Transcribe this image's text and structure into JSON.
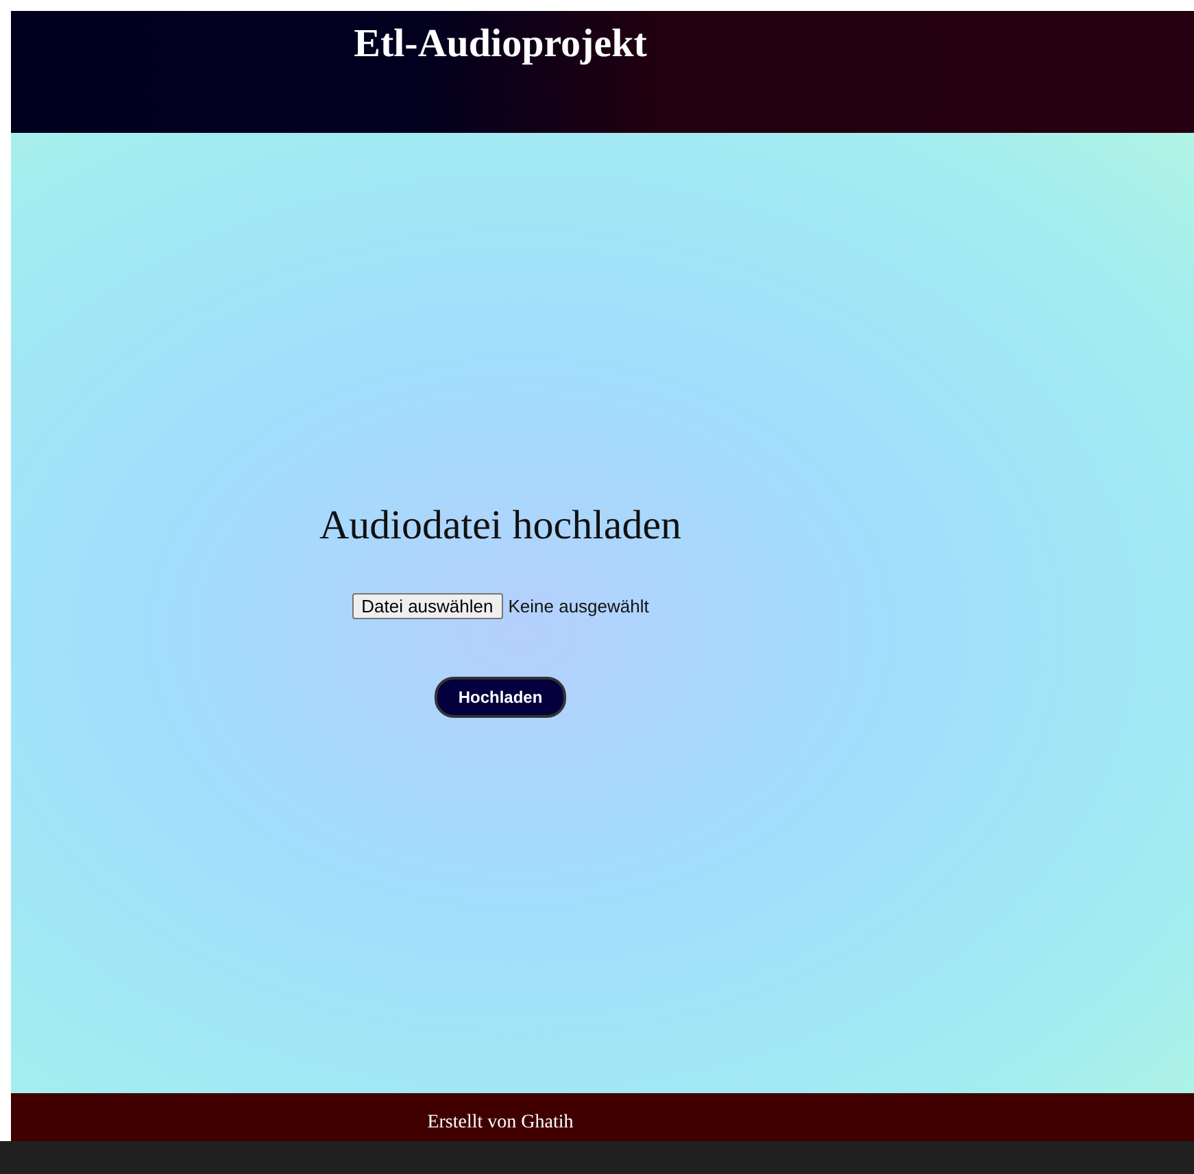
{
  "header": {
    "title": "Etl-Audioprojekt"
  },
  "upload": {
    "heading": "Audiodatei hochladen",
    "file_button": "Datei auswählen",
    "file_status": "Keine ausgewählt",
    "submit_button": "Hochladen"
  },
  "footer": {
    "text": "Erstellt von Ghatih"
  }
}
